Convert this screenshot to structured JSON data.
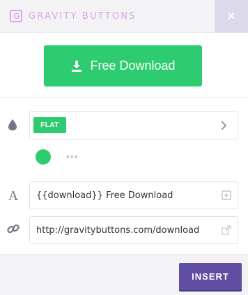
{
  "header": {
    "logo_letter": "G",
    "brand": "GRAVITY BUTTONS",
    "close_label": "×"
  },
  "preview": {
    "button_label": "Free Download",
    "button_color": "#2ecc71",
    "button_icon": "download-icon"
  },
  "style": {
    "badge_label": "FLAT",
    "icon": "droplet-icon"
  },
  "colors": {
    "selected": "#2ecc71",
    "more_label": "•••"
  },
  "text_field": {
    "icon": "font-icon",
    "value": "{{download}} Free Download",
    "action_icon": "add-icon"
  },
  "link_field": {
    "icon": "link-icon",
    "value": "http://gravitybuttons.com/download",
    "action_icon": "external-link-icon"
  },
  "footer": {
    "insert_label": "INSERT",
    "insert_color": "#5f4ea1"
  }
}
